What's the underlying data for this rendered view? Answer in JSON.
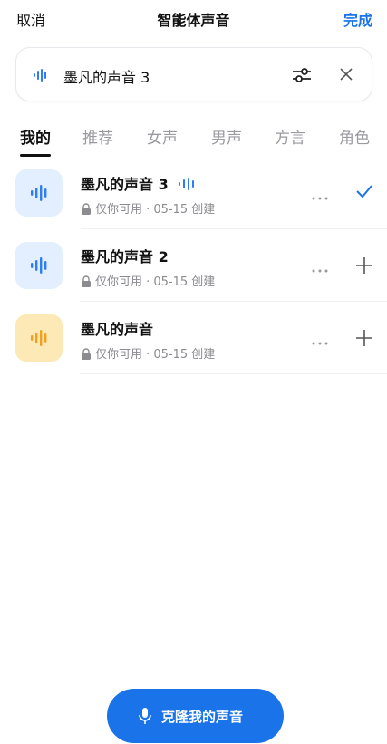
{
  "header": {
    "cancel_label": "取消",
    "title": "智能体声音",
    "done_label": "完成"
  },
  "search": {
    "selected_voice": "墨凡的声音 3",
    "icons": [
      "sound-wave-icon",
      "sliders-icon",
      "close-icon"
    ]
  },
  "tabs": [
    {
      "label": "我的",
      "active": true
    },
    {
      "label": "推荐",
      "active": false
    },
    {
      "label": "女声",
      "active": false
    },
    {
      "label": "男声",
      "active": false
    },
    {
      "label": "方言",
      "active": false
    },
    {
      "label": "角色",
      "active": false
    }
  ],
  "voices": [
    {
      "name": "墨凡的声音 3",
      "meta": "仅你可用 · 05-15 创建",
      "avatar_bg": "#e3efff",
      "wave_color": "#2f7cf6",
      "playing": true,
      "action": "check"
    },
    {
      "name": "墨凡的声音 2",
      "meta": "仅你可用 · 05-15 创建",
      "avatar_bg": "#e3efff",
      "wave_color": "#2f7cf6",
      "playing": false,
      "action": "add"
    },
    {
      "name": "墨凡的声音",
      "meta": "仅你可用 · 05-15 创建",
      "avatar_bg": "#fde9b5",
      "wave_color": "#f0a020",
      "playing": false,
      "action": "add"
    }
  ],
  "clone_button": {
    "label": "克隆我的声音"
  },
  "colors": {
    "accent": "#1a73e8",
    "text": "#111111",
    "muted": "#8b8b90"
  }
}
